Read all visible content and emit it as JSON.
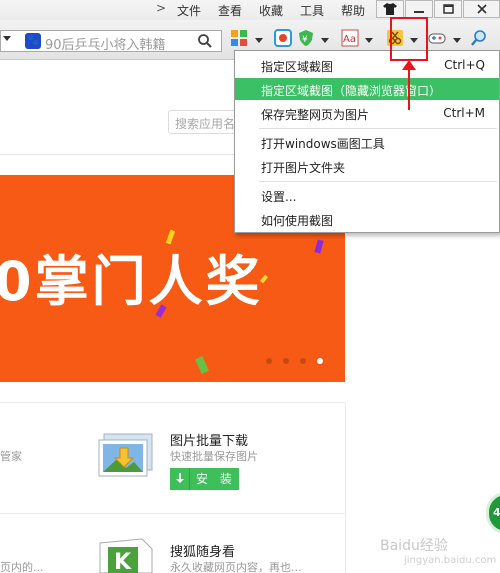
{
  "menubar": {
    "arrow": ">",
    "items": [
      "文件",
      "查看",
      "收藏",
      "工具",
      "帮助"
    ]
  },
  "toolbar": {
    "search_placeholder": "90后乒乓小将入韩籍",
    "paw": "🐾"
  },
  "screenshot_menu": {
    "items": [
      {
        "label": "指定区域截图",
        "shortcut": "Ctrl+Q"
      },
      {
        "label": "指定区域截图（隐藏浏览器窗口）",
        "shortcut": "",
        "highlighted": true
      },
      {
        "label": "保存完整网页为图片",
        "shortcut": "Ctrl+M"
      },
      {
        "label": "打开windows画图工具",
        "shortcut": ""
      },
      {
        "label": "打开图片文件夹",
        "shortcut": ""
      },
      {
        "label": "设置...",
        "shortcut": ""
      },
      {
        "label": "如何使用截图",
        "shortcut": ""
      }
    ]
  },
  "page": {
    "search_placeholder": "搜索应用名",
    "banner_text": "0掌门人奖",
    "apps": [
      {
        "title": "图片批量下载",
        "desc": "快速批量保存图片",
        "button": "安 装"
      },
      {
        "title": "搜狐随身看",
        "desc": "永久收藏网页内容，再也..."
      }
    ],
    "left_clips": [
      "管家",
      "页内的..."
    ],
    "badge": "46",
    "watermark": "Baidu经验",
    "watermark_url": "jingyan.baidu.com"
  },
  "colors": {
    "accent_green": "#3cc065",
    "banner_orange": "#f65a15",
    "highlight_red": "#e8141b"
  }
}
